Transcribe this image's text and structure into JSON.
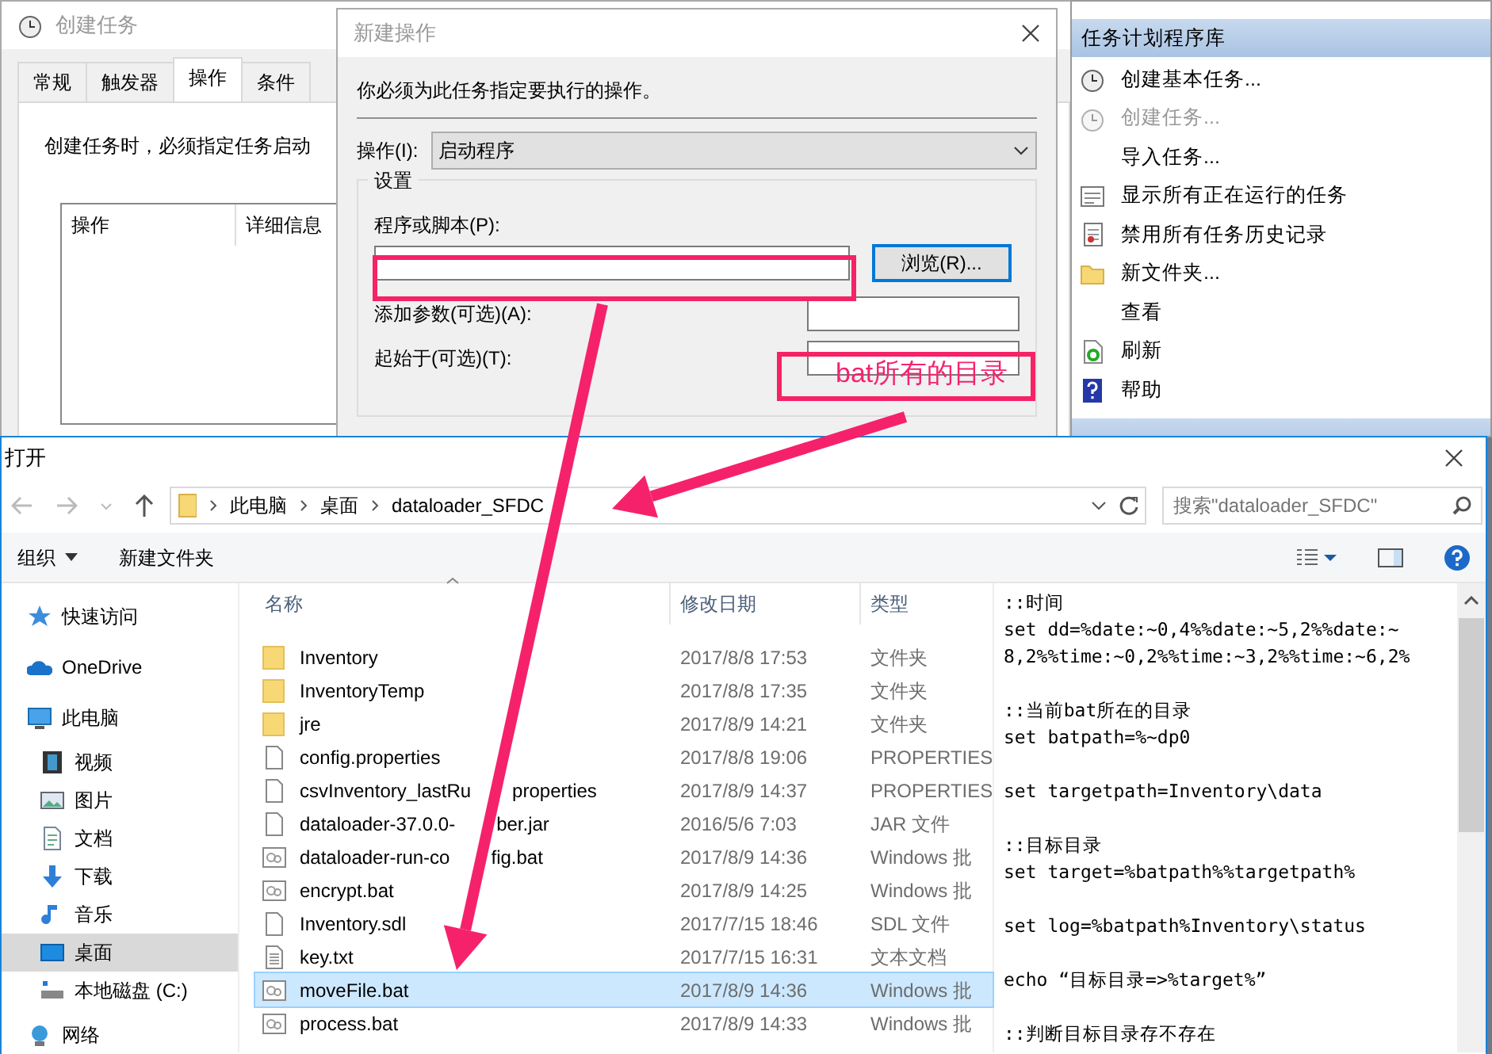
{
  "task_window": {
    "title": "创建任务",
    "tabs": [
      {
        "label": "常规",
        "selected": false
      },
      {
        "label": "触发器",
        "selected": false
      },
      {
        "label": "操作",
        "selected": true
      },
      {
        "label": "条件",
        "selected": false
      }
    ],
    "hint": "创建任务时，必须指定任务启动",
    "columns": [
      "操作",
      "详细信息"
    ]
  },
  "actions_panel": {
    "header": "任务计划程序库",
    "items": [
      {
        "label": "创建基本任务...",
        "kind": "clock",
        "disabled": false
      },
      {
        "label": "创建任务...",
        "kind": "clock",
        "disabled": true
      },
      {
        "label": "导入任务...",
        "kind": "plain",
        "disabled": false
      },
      {
        "label": "显示所有正在运行的任务",
        "kind": "list",
        "disabled": false
      },
      {
        "label": "禁用所有任务历史记录",
        "kind": "notebook",
        "disabled": false
      },
      {
        "label": "新文件夹...",
        "kind": "folder",
        "disabled": false
      },
      {
        "label": "查看",
        "kind": "plain",
        "disabled": false
      },
      {
        "label": "刷新",
        "kind": "refresh",
        "disabled": false
      },
      {
        "label": "帮助",
        "kind": "help",
        "disabled": false
      }
    ]
  },
  "action_dialog": {
    "title": "新建操作",
    "instruction": "你必须为此任务指定要执行的操作。",
    "action_label": "操作(I):",
    "action_value": "启动程序",
    "group": "设置",
    "program_label": "程序或脚本(P):",
    "browse": "浏览(R)...",
    "args_label": "添加参数(可选)(A):",
    "start_label": "起始于(可选)(T):"
  },
  "open_dialog": {
    "title": "打开",
    "breadcrumb": [
      "此电脑",
      "桌面",
      "dataloader_SFDC"
    ],
    "search": {
      "placeholder": "搜索\"dataloader_SFDC\""
    },
    "toolbar": {
      "organize": "组织",
      "new_folder": "新建文件夹"
    },
    "nav": [
      {
        "label": "快速访问",
        "kind": "star",
        "selected": false
      },
      {
        "label": "OneDrive",
        "kind": "cloud",
        "selected": false
      },
      {
        "label": "此电脑",
        "kind": "pc",
        "selected": false,
        "children": [
          {
            "label": "视频",
            "kind": "video",
            "selected": false
          },
          {
            "label": "图片",
            "kind": "picture",
            "selected": false
          },
          {
            "label": "文档",
            "kind": "doc",
            "selected": false
          },
          {
            "label": "下载",
            "kind": "download",
            "selected": false
          },
          {
            "label": "音乐",
            "kind": "music",
            "selected": false
          },
          {
            "label": "桌面",
            "kind": "desktop",
            "selected": true
          },
          {
            "label": "本地磁盘 (C:)",
            "kind": "disk",
            "selected": false
          }
        ]
      },
      {
        "label": "网络",
        "kind": "network",
        "selected": false
      }
    ],
    "columns": [
      "名称",
      "修改日期",
      "类型"
    ],
    "files": [
      {
        "name": [
          "Inventory"
        ],
        "date": "2017/8/8 17:53",
        "type": "文件夹",
        "kind": "folder",
        "selected": false
      },
      {
        "name": [
          "InventoryTemp"
        ],
        "date": "2017/8/8 17:35",
        "type": "文件夹",
        "kind": "folder",
        "selected": false
      },
      {
        "name": [
          "jre"
        ],
        "date": "2017/8/9 14:21",
        "type": "文件夹",
        "kind": "folder",
        "selected": false
      },
      {
        "name": [
          "config.properties"
        ],
        "date": "2017/8/8 19:06",
        "type": "PROPERTIES",
        "kind": "file",
        "selected": false
      },
      {
        "name": [
          "csvInventory_lastRu",
          "properties"
        ],
        "date": "2017/8/9 14:37",
        "type": "PROPERTIES",
        "kind": "file",
        "selected": false
      },
      {
        "name": [
          "dataloader-37.0.0-",
          "ber.jar"
        ],
        "date": "2016/5/6 7:03",
        "type": "JAR 文件",
        "kind": "file",
        "selected": false
      },
      {
        "name": [
          "dataloader-run-co",
          "fig.bat"
        ],
        "date": "2017/8/9 14:36",
        "type": "Windows 批",
        "kind": "bat",
        "selected": false
      },
      {
        "name": [
          "encrypt.bat"
        ],
        "date": "2017/8/9 14:25",
        "type": "Windows 批",
        "kind": "bat",
        "selected": false
      },
      {
        "name": [
          "Inventory.sdl"
        ],
        "date": "2017/7/15 18:46",
        "type": "SDL 文件",
        "kind": "file",
        "selected": false
      },
      {
        "name": [
          "key.txt"
        ],
        "date": "2017/7/15 16:31",
        "type": "文本文档",
        "kind": "txt",
        "selected": false
      },
      {
        "name": [
          "moveFile.bat"
        ],
        "date": "2017/8/9 14:36",
        "type": "Windows 批",
        "kind": "bat",
        "selected": true
      },
      {
        "name": [
          "process.bat"
        ],
        "date": "2017/8/9 14:33",
        "type": "Windows 批",
        "kind": "bat",
        "selected": false
      }
    ],
    "preview": [
      [
        "::时间",
        "set dd=%date:~0,4%%date:~5,2%%date:~",
        "8,2%%time:~0,2%%time:~3,2%%time:~6,2%"
      ],
      [
        "::当前bat所在的目录",
        "set batpath=%~dp0"
      ],
      [
        "set targetpath=Inventory\\data"
      ],
      [
        "::目标目录",
        "set target=%batpath%%targetpath%"
      ],
      [
        "set log=%batpath%Inventory\\status"
      ],
      [
        "echo “目标目录=>%target%”"
      ],
      [
        "::判断目标目录存不存在"
      ]
    ]
  },
  "annotations": [
    {
      "kind": "box"
    },
    {
      "kind": "box",
      "text": "bat所有的目录"
    },
    {
      "kind": "arrow"
    },
    {
      "kind": "arrow"
    }
  ]
}
